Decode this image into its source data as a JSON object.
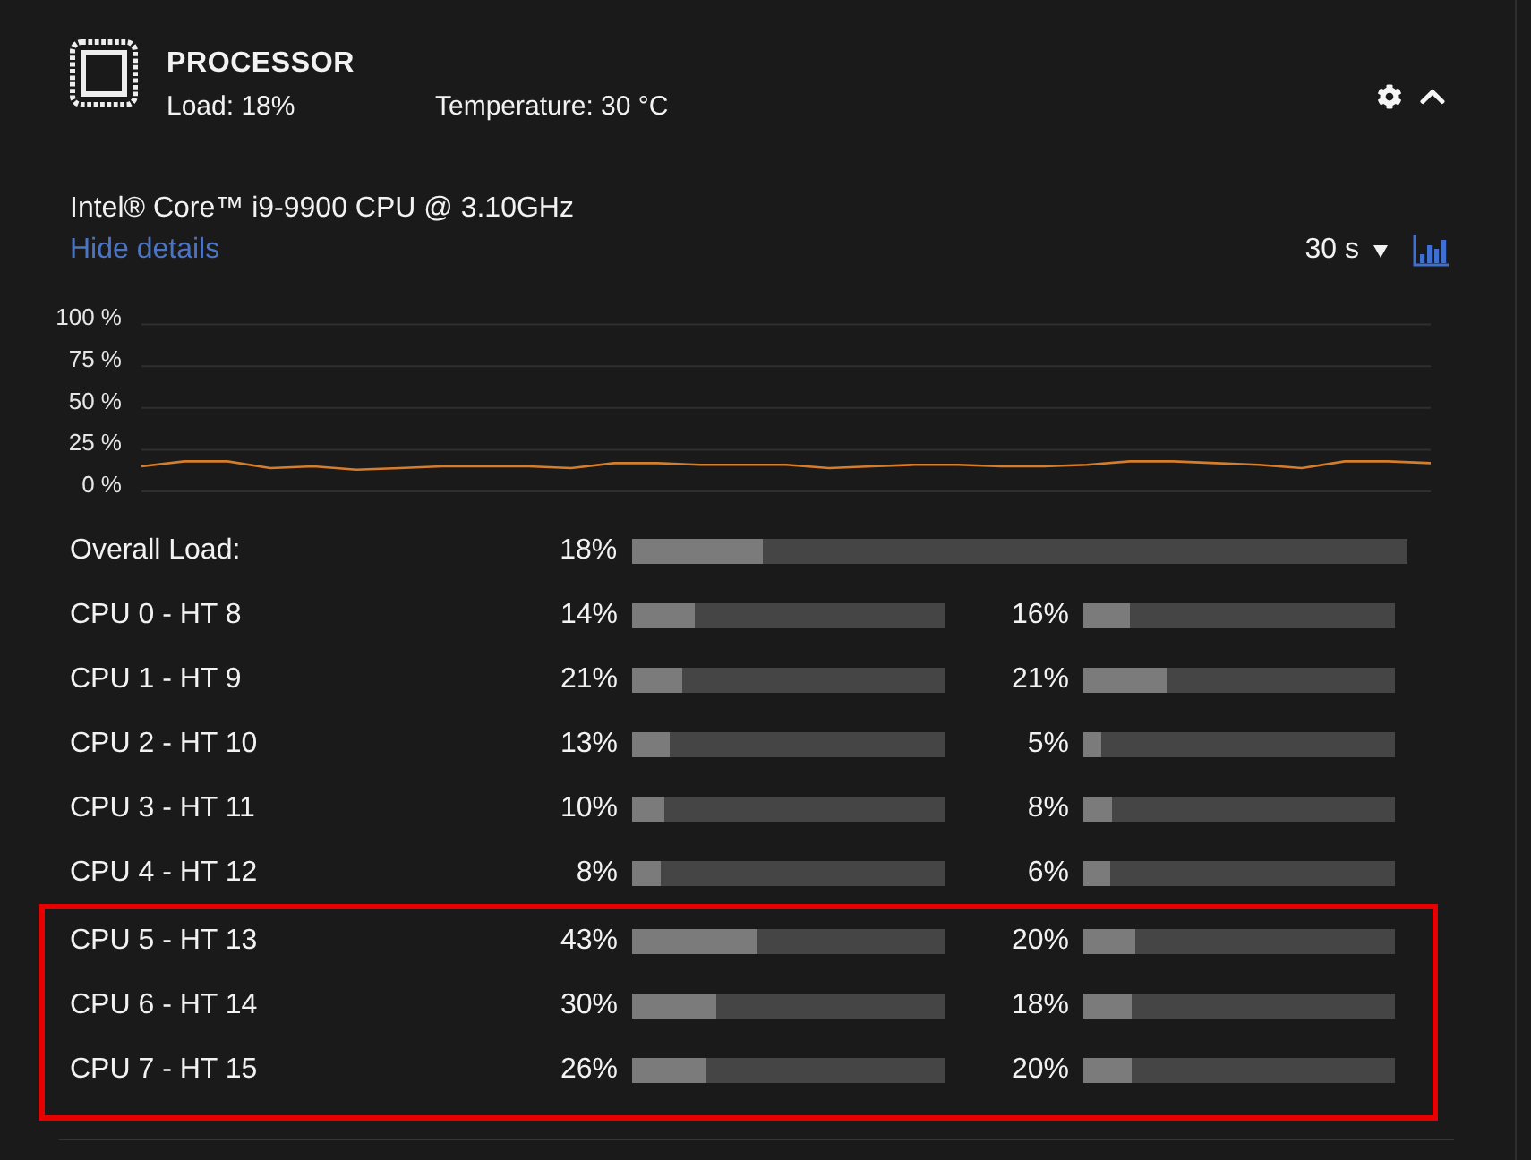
{
  "panel": {
    "title": "PROCESSOR",
    "load": "Load: 18%",
    "temperature": "Temperature: 30 °C",
    "expanded": true
  },
  "details": {
    "model": "Intel® Core™ i9-9900 CPU @ 3.10GHz",
    "toggle_link": "Hide details",
    "interval": "30 s"
  },
  "load_history": {
    "chart_data": {
      "type": "line",
      "grid": true,
      "ylim": [
        0,
        100
      ],
      "yticks": [
        {
          "value": 0,
          "label": "0 %"
        },
        {
          "value": 25,
          "label": "25 %"
        },
        {
          "value": 50,
          "label": "50 %"
        },
        {
          "value": 75,
          "label": "75 %"
        },
        {
          "value": 100,
          "label": "100 %"
        }
      ],
      "values": [
        15,
        18,
        18,
        14,
        15,
        13,
        14,
        15,
        15,
        15,
        14,
        17,
        17,
        16,
        16,
        16,
        14,
        15,
        16,
        16,
        15,
        15,
        16,
        18,
        18,
        17,
        16,
        14,
        18,
        18,
        17
      ]
    }
  },
  "overall": {
    "label": "Overall Load:",
    "reading": "18%",
    "level": 0.17
  },
  "cores": [
    {
      "label": "CPU 0 - HT 8",
      "highlighted": false,
      "readings": [
        {
          "reading": "14%",
          "level": 0.2
        },
        {
          "reading": "16%",
          "level": 0.15
        }
      ]
    },
    {
      "label": "CPU 1 - HT 9",
      "highlighted": false,
      "readings": [
        {
          "reading": "21%",
          "level": 0.16
        },
        {
          "reading": "21%",
          "level": 0.27
        }
      ]
    },
    {
      "label": "CPU 2 - HT 10",
      "highlighted": false,
      "readings": [
        {
          "reading": "13%",
          "level": 0.12
        },
        {
          "reading": "5%",
          "level": 0.06
        }
      ]
    },
    {
      "label": "CPU 3 - HT 11",
      "highlighted": false,
      "readings": [
        {
          "reading": "10%",
          "level": 0.1
        },
        {
          "reading": "8%",
          "level": 0.09
        }
      ]
    },
    {
      "label": "CPU 4 - HT 12",
      "highlighted": false,
      "readings": [
        {
          "reading": "8%",
          "level": 0.09
        },
        {
          "reading": "6%",
          "level": 0.085
        }
      ]
    },
    {
      "label": "CPU 5 - HT 13",
      "highlighted": true,
      "readings": [
        {
          "reading": "43%",
          "level": 0.4
        },
        {
          "reading": "20%",
          "level": 0.165
        }
      ]
    },
    {
      "label": "CPU 6 - HT 14",
      "highlighted": true,
      "readings": [
        {
          "reading": "30%",
          "level": 0.27
        },
        {
          "reading": "18%",
          "level": 0.155
        }
      ]
    },
    {
      "label": "CPU 7 - HT 15",
      "highlighted": true,
      "readings": [
        {
          "reading": "26%",
          "level": 0.235
        },
        {
          "reading": "20%",
          "level": 0.155
        }
      ]
    }
  ]
}
